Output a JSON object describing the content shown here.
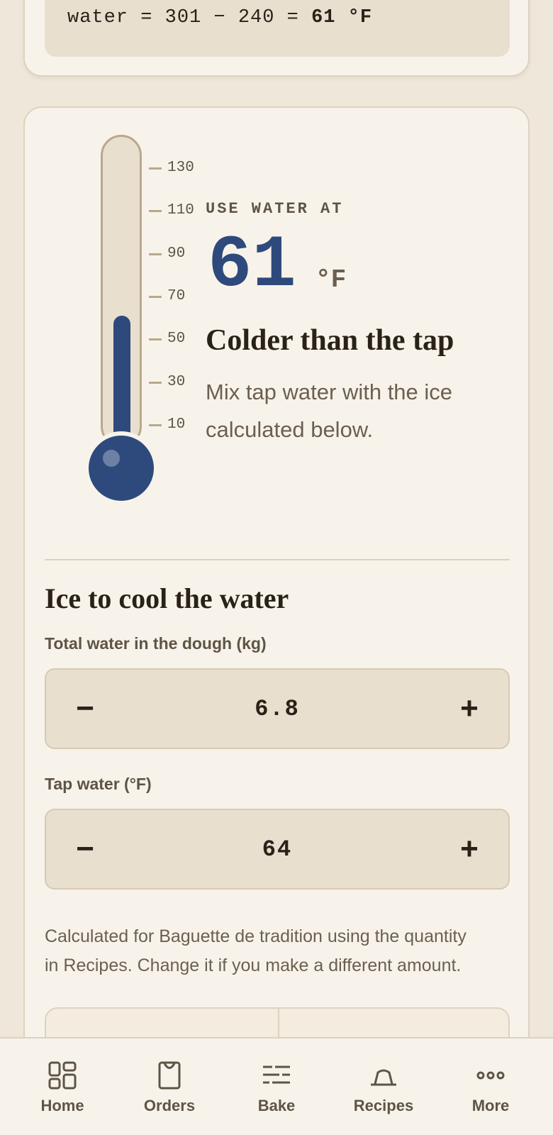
{
  "formula": {
    "prefix": "water = 301 − 240 = ",
    "result": "61 °F"
  },
  "thermometer": {
    "scale_min": 0,
    "scale_max": 140,
    "current_value": 61,
    "ticks": [
      "130",
      "110",
      "90",
      "70",
      "50",
      "30",
      "10"
    ]
  },
  "result": {
    "eyebrow": "USE WATER AT",
    "temperature": "61",
    "unit": "°F",
    "title": "Colder than the tap",
    "description": "Mix tap water with the ice calculated below."
  },
  "ice": {
    "title": "Ice to cool the water",
    "total_water_label": "Total water in the dough (kg)",
    "total_water_value": "6.8",
    "tap_water_label": "Tap water (°F)",
    "tap_water_value": "64",
    "minus_label": "−",
    "plus_label": "+",
    "note": "Calculated for Baguette de tradition using the quantity in Recipes. Change it if you make a different amount."
  },
  "nav": {
    "items": [
      {
        "label": "Home",
        "icon": "home-grid-icon"
      },
      {
        "label": "Orders",
        "icon": "orders-bag-icon"
      },
      {
        "label": "Bake",
        "icon": "bake-lines-icon"
      },
      {
        "label": "Recipes",
        "icon": "recipes-pan-icon"
      },
      {
        "label": "More",
        "icon": "more-dots-icon"
      }
    ]
  },
  "colors": {
    "accent": "#2e4a7d",
    "background": "#efe8da",
    "card": "#f8f3ea",
    "input": "#e8dfcf",
    "border": "#ddd2bf"
  }
}
